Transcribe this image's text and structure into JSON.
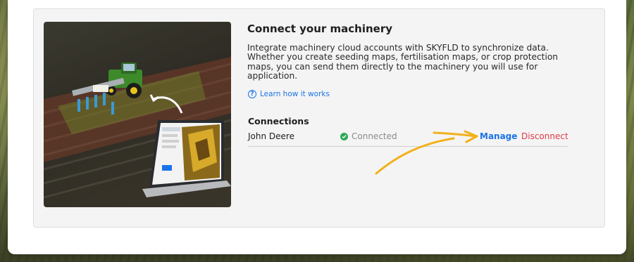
{
  "card": {
    "title": "Connect your machinery",
    "description": "Integrate machinery cloud accounts with SKYFLD to synchronize data. Whether you create seeding maps, fertilisation maps, or crop protection maps, you can send them directly to the machinery you will use for application.",
    "learn_link": "Learn how it works",
    "connections_heading": "Connections"
  },
  "connections": [
    {
      "provider": "John Deere",
      "status": "Connected",
      "manage_label": "Manage",
      "disconnect_label": "Disconnect"
    }
  ],
  "colors": {
    "link_blue": "#1a73e8",
    "disconnect_red": "#e53946",
    "connected_green": "#2eaa5a",
    "annotation_arrow": "#f2b11a"
  },
  "icons": {
    "help": "question-circle-icon",
    "connected": "check-circle-icon",
    "annotation": "curved-arrow-icon"
  }
}
